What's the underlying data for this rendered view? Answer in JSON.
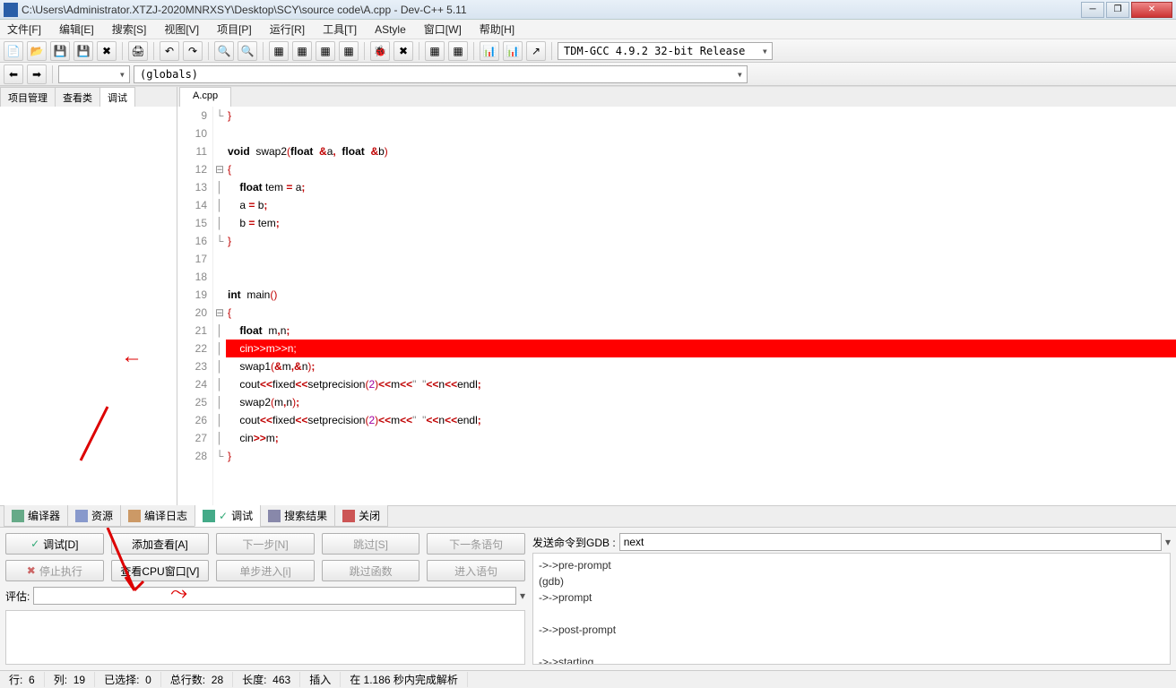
{
  "title": "C:\\Users\\Administrator.XTZJ-2020MNRXSY\\Desktop\\SCY\\source code\\A.cpp - Dev-C++ 5.11",
  "menus": [
    "文件[F]",
    "编辑[E]",
    "搜索[S]",
    "视图[V]",
    "项目[P]",
    "运行[R]",
    "工具[T]",
    "AStyle",
    "窗口[W]",
    "帮助[H]"
  ],
  "compiler_combo": "TDM-GCC 4.9.2 32-bit Release",
  "globals_combo": "(globals)",
  "left_tabs": [
    "项目管理",
    "查看类",
    "调试"
  ],
  "left_active": 2,
  "editor_tab": "A.cpp",
  "lines": [
    {
      "n": 9,
      "fold": "└",
      "tokens": [
        {
          "t": "}",
          "c": "br"
        }
      ]
    },
    {
      "n": 10,
      "fold": "",
      "tokens": []
    },
    {
      "n": 11,
      "fold": "",
      "tokens": [
        {
          "t": "void",
          "c": "kw"
        },
        {
          "t": "  swap2"
        },
        {
          "t": "(",
          "c": "br"
        },
        {
          "t": "float",
          "c": "kw"
        },
        {
          "t": "  "
        },
        {
          "t": "&",
          "c": "op"
        },
        {
          "t": "a"
        },
        {
          "t": ",",
          "c": "op"
        },
        {
          "t": "  "
        },
        {
          "t": "float",
          "c": "kw"
        },
        {
          "t": "  "
        },
        {
          "t": "&",
          "c": "op"
        },
        {
          "t": "b"
        },
        {
          "t": ")",
          "c": "br"
        }
      ]
    },
    {
      "n": 12,
      "fold": "⊟",
      "tokens": [
        {
          "t": "{",
          "c": "br"
        }
      ]
    },
    {
      "n": 13,
      "fold": "│",
      "tokens": [
        {
          "t": "    "
        },
        {
          "t": "float",
          "c": "kw"
        },
        {
          "t": " tem "
        },
        {
          "t": "=",
          "c": "op"
        },
        {
          "t": " a"
        },
        {
          "t": ";",
          "c": "op"
        }
      ]
    },
    {
      "n": 14,
      "fold": "│",
      "tokens": [
        {
          "t": "    a "
        },
        {
          "t": "=",
          "c": "op"
        },
        {
          "t": " b"
        },
        {
          "t": ";",
          "c": "op"
        }
      ]
    },
    {
      "n": 15,
      "fold": "│",
      "tokens": [
        {
          "t": "    b "
        },
        {
          "t": "=",
          "c": "op"
        },
        {
          "t": " tem"
        },
        {
          "t": ";",
          "c": "op"
        }
      ]
    },
    {
      "n": 16,
      "fold": "└",
      "tokens": [
        {
          "t": "}",
          "c": "br"
        }
      ]
    },
    {
      "n": 17,
      "fold": "",
      "tokens": []
    },
    {
      "n": 18,
      "fold": "",
      "tokens": []
    },
    {
      "n": 19,
      "fold": "",
      "tokens": [
        {
          "t": "int",
          "c": "kw"
        },
        {
          "t": "  main"
        },
        {
          "t": "()",
          "c": "br"
        }
      ]
    },
    {
      "n": 20,
      "fold": "⊟",
      "tokens": [
        {
          "t": "{",
          "c": "br"
        }
      ]
    },
    {
      "n": 21,
      "fold": "│",
      "tokens": [
        {
          "t": "    "
        },
        {
          "t": "float",
          "c": "kw"
        },
        {
          "t": "  m"
        },
        {
          "t": ",",
          "c": "op"
        },
        {
          "t": "n"
        },
        {
          "t": ";",
          "c": "op"
        }
      ]
    },
    {
      "n": 22,
      "fold": "│",
      "cur": true,
      "tokens": [
        {
          "t": "    cin>>m>>n;"
        }
      ]
    },
    {
      "n": 23,
      "fold": "│",
      "tokens": [
        {
          "t": "    swap1"
        },
        {
          "t": "(",
          "c": "br"
        },
        {
          "t": "&",
          "c": "op"
        },
        {
          "t": "m"
        },
        {
          "t": ",",
          "c": "op"
        },
        {
          "t": "&",
          "c": "op"
        },
        {
          "t": "n"
        },
        {
          "t": ")",
          "c": "br"
        },
        {
          "t": ";",
          "c": "op"
        }
      ]
    },
    {
      "n": 24,
      "fold": "│",
      "tokens": [
        {
          "t": "    cout"
        },
        {
          "t": "<<",
          "c": "op"
        },
        {
          "t": "fixed"
        },
        {
          "t": "<<",
          "c": "op"
        },
        {
          "t": "setprecision"
        },
        {
          "t": "(",
          "c": "br"
        },
        {
          "t": "2",
          "c": "num"
        },
        {
          "t": ")",
          "c": "br"
        },
        {
          "t": "<<",
          "c": "op"
        },
        {
          "t": "m"
        },
        {
          "t": "<<",
          "c": "op"
        },
        {
          "t": "\"  \"",
          "c": "str"
        },
        {
          "t": "<<",
          "c": "op"
        },
        {
          "t": "n"
        },
        {
          "t": "<<",
          "c": "op"
        },
        {
          "t": "endl"
        },
        {
          "t": ";",
          "c": "op"
        }
      ]
    },
    {
      "n": 25,
      "fold": "│",
      "tokens": [
        {
          "t": "    swap2"
        },
        {
          "t": "(",
          "c": "br"
        },
        {
          "t": "m"
        },
        {
          "t": ",",
          "c": "op"
        },
        {
          "t": "n"
        },
        {
          "t": ")",
          "c": "br"
        },
        {
          "t": ";",
          "c": "op"
        }
      ]
    },
    {
      "n": 26,
      "fold": "│",
      "tokens": [
        {
          "t": "    cout"
        },
        {
          "t": "<<",
          "c": "op"
        },
        {
          "t": "fixed"
        },
        {
          "t": "<<",
          "c": "op"
        },
        {
          "t": "setprecision"
        },
        {
          "t": "(",
          "c": "br"
        },
        {
          "t": "2",
          "c": "num"
        },
        {
          "t": ")",
          "c": "br"
        },
        {
          "t": "<<",
          "c": "op"
        },
        {
          "t": "m"
        },
        {
          "t": "<<",
          "c": "op"
        },
        {
          "t": "\"  \"",
          "c": "str"
        },
        {
          "t": "<<",
          "c": "op"
        },
        {
          "t": "n"
        },
        {
          "t": "<<",
          "c": "op"
        },
        {
          "t": "endl"
        },
        {
          "t": ";",
          "c": "op"
        }
      ]
    },
    {
      "n": 27,
      "fold": "│",
      "tokens": [
        {
          "t": "    cin"
        },
        {
          "t": ">>",
          "c": "op"
        },
        {
          "t": "m"
        },
        {
          "t": ";",
          "c": "op"
        }
      ]
    },
    {
      "n": 28,
      "fold": "└",
      "tokens": [
        {
          "t": "}",
          "c": "br"
        }
      ]
    }
  ],
  "bottom_tabs": [
    {
      "label": "编译器",
      "icon": "#6a8"
    },
    {
      "label": "资源",
      "icon": "#89c"
    },
    {
      "label": "编译日志",
      "icon": "#c96"
    },
    {
      "label": "调试",
      "icon": "#4a8",
      "active": true,
      "check": true
    },
    {
      "label": "搜索结果",
      "icon": "#88a"
    },
    {
      "label": "关闭",
      "icon": "#c55"
    }
  ],
  "dbg_buttons_row1": [
    {
      "label": "调试[D]",
      "check": true
    },
    {
      "label": "添加查看[A]"
    },
    {
      "label": "下一步[N]",
      "disabled": true
    },
    {
      "label": "跳过[S]",
      "disabled": true
    },
    {
      "label": "下一条语句",
      "disabled": true
    }
  ],
  "dbg_buttons_row2": [
    {
      "label": "停止执行",
      "disabled": true,
      "x": true
    },
    {
      "label": "查看CPU窗口[V]"
    },
    {
      "label": "单步进入[i]",
      "disabled": true
    },
    {
      "label": "跳过函数",
      "disabled": true
    },
    {
      "label": "进入语句",
      "disabled": true
    }
  ],
  "eval_label": "评估:",
  "gdb_label": "发送命令到GDB :",
  "gdb_cmd": "next",
  "gdb_output": [
    "->->pre-prompt",
    "(gdb)",
    "->->prompt",
    "",
    "->->post-prompt",
    "",
    "->->starting"
  ],
  "status": {
    "line_label": "行:",
    "line": "6",
    "col_label": "列:",
    "col": "19",
    "sel_label": "已选择:",
    "sel": "0",
    "total_label": "总行数:",
    "total": "28",
    "len_label": "长度:",
    "len": "463",
    "ins": "插入",
    "msg": "在 1.186 秒内完成解析"
  }
}
